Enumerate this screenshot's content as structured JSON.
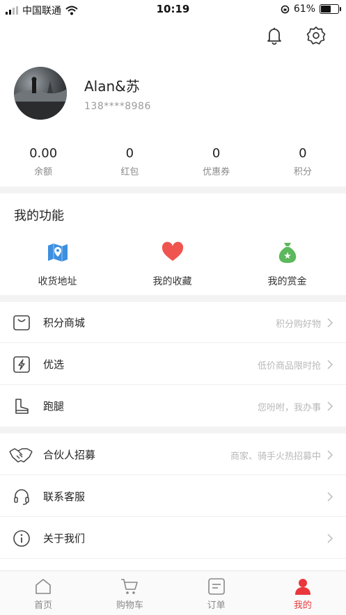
{
  "status_bar": {
    "carrier": "中国联通",
    "time": "10:19",
    "battery": "61%"
  },
  "profile": {
    "name": "Alan&苏",
    "phone": "138****8986"
  },
  "stats": [
    {
      "value": "0.00",
      "label": "余额"
    },
    {
      "value": "0",
      "label": "红包"
    },
    {
      "value": "0",
      "label": "优惠券"
    },
    {
      "value": "0",
      "label": "积分"
    }
  ],
  "features": {
    "title": "我的功能",
    "items": [
      {
        "label": "收货地址",
        "icon": "map-icon"
      },
      {
        "label": "我的收藏",
        "icon": "heart-icon"
      },
      {
        "label": "我的赏金",
        "icon": "money-bag-icon"
      }
    ]
  },
  "menu": [
    {
      "title": "积分商城",
      "hint": "积分购好物",
      "icon": "shopping-bag-icon"
    },
    {
      "title": "优选",
      "hint": "低价商品限时抢",
      "icon": "lightning-icon"
    },
    {
      "title": "跑腿",
      "hint": "您吩咐，我办事",
      "icon": "boot-icon"
    },
    {
      "title": "合伙人招募",
      "hint": "商家、骑手火热招募中",
      "icon": "handshake-icon"
    },
    {
      "title": "联系客服",
      "hint": "",
      "icon": "headset-icon"
    },
    {
      "title": "关于我们",
      "hint": "",
      "icon": "info-icon"
    }
  ],
  "tabbar": [
    {
      "label": "首页",
      "icon": "home-icon",
      "active": false
    },
    {
      "label": "购物车",
      "icon": "cart-icon",
      "active": false
    },
    {
      "label": "订单",
      "icon": "order-icon",
      "active": false
    },
    {
      "label": "我的",
      "icon": "user-icon",
      "active": true
    }
  ],
  "colors": {
    "accent": "#e8383d",
    "map": "#3d8fe0",
    "heart": "#f0544f",
    "money": "#5cb85c"
  }
}
